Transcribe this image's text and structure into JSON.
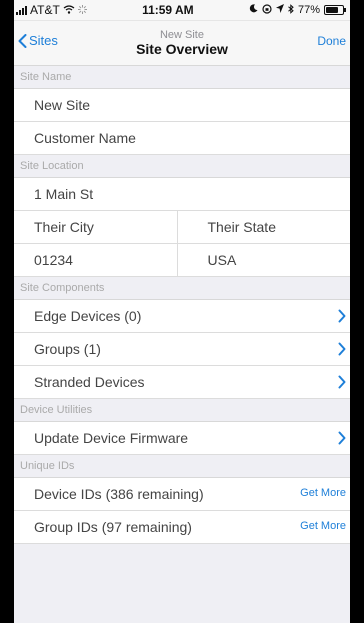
{
  "status_bar": {
    "carrier": "AT&T",
    "time": "11:59 AM",
    "battery": "77%"
  },
  "nav": {
    "back_label": "Sites",
    "subtitle": "New Site",
    "title": "Site Overview",
    "done_label": "Done"
  },
  "site_name": {
    "header": "Site Name",
    "name": "New Site",
    "customer": "Customer Name"
  },
  "site_location": {
    "header": "Site Location",
    "street": "1 Main St",
    "city": "Their City",
    "state": "Their State",
    "zip": "01234",
    "country": "USA"
  },
  "site_components": {
    "header": "Site Components",
    "items": [
      "Edge Devices (0)",
      "Groups (1)",
      "Stranded Devices"
    ]
  },
  "device_utilities": {
    "header": "Device Utilities",
    "items": [
      "Update Device Firmware"
    ]
  },
  "unique_ids": {
    "header": "Unique IDs",
    "items": [
      {
        "label": "Device IDs (386 remaining)",
        "action": "Get More"
      },
      {
        "label": "Group IDs (97 remaining)",
        "action": "Get More"
      }
    ]
  },
  "colors": {
    "accent": "#1e7fd8",
    "background": "#efeff4",
    "header_text": "#aaaaaa"
  }
}
